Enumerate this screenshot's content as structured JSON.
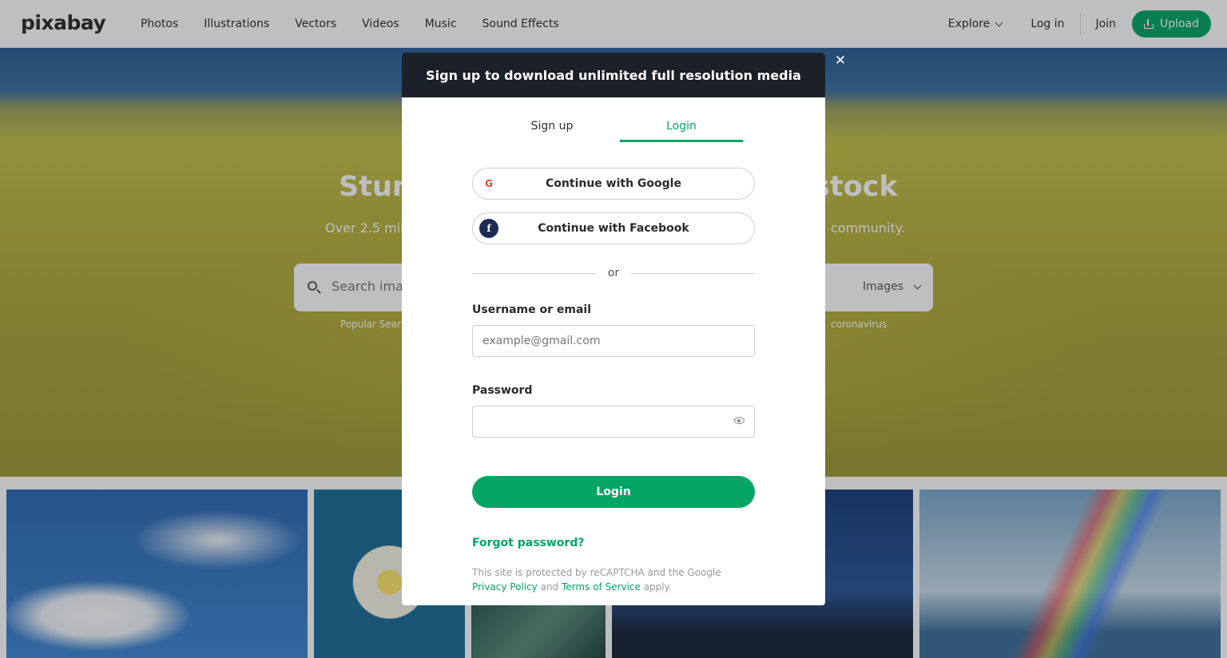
{
  "header": {
    "logo": "pixabay",
    "nav": [
      "Photos",
      "Illustrations",
      "Vectors",
      "Videos",
      "Music",
      "Sound Effects"
    ],
    "explore": "Explore",
    "login": "Log in",
    "join": "Join",
    "upload": "Upload"
  },
  "hero": {
    "title_left": "Stunn",
    "title_right": "stock",
    "sub_left": "Over 2.5 milli",
    "sub_right": "community.",
    "search_placeholder": "Search images",
    "search_type": "Images",
    "popular_left": "Popular Searc",
    "popular_right": "coronavirus"
  },
  "modal": {
    "heading": "Sign up to download unlimited full resolution media",
    "close": "✕",
    "tab_signup": "Sign up",
    "tab_login": "Login",
    "google": "Continue with Google",
    "google_icon": "G",
    "facebook": "Continue with Facebook",
    "facebook_icon": "f",
    "or": "or",
    "user_label": "Username or email",
    "user_placeholder": "example@gmail.com",
    "pass_label": "Password",
    "login_button": "Login",
    "forgot": "Forgot password?",
    "legal_prefix": "This site is protected by reCAPTCHA and the Google ",
    "privacy": "Privacy Policy",
    "and": " and ",
    "terms": "Terms of Service",
    "legal_suffix": " apply."
  },
  "colors": {
    "brand": "#05a566",
    "modal_header": "#1b2029"
  }
}
